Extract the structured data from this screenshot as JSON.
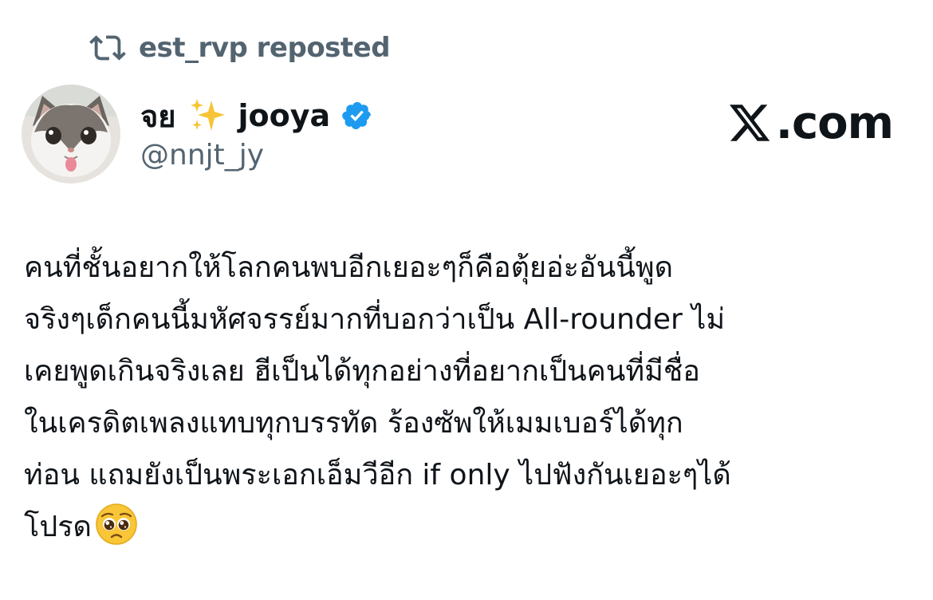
{
  "repost": {
    "icon": "repost-icon",
    "text": "est_rvp reposted"
  },
  "author": {
    "avatar": "cat-avatar",
    "name_part1": "จย",
    "name_emoji": "sparkles-icon",
    "name_part2": "jooya",
    "verified_icon": "verified-badge-icon",
    "verified_color": "#1d9bf0",
    "handle": "@nnjt_jy"
  },
  "brand": {
    "logo": "x-logo-icon",
    "text": ".com"
  },
  "tweet": {
    "lines": [
      "คนที่ชั้นอยากให้โลกคนพบอีกเยอะๆก็คือตุ้ยอ่ะอันนี้พูด",
      "จริงๆเด็กคนนี้มหัศจรรย์มากที่บอกว่าเป็น All-rounder ไม่",
      "เคยพูดเกินจริงเลย ฮีเป็นได้ทุกอย่างที่อยากเป็นคนที่มีชื่อ",
      "ในเครดิตเพลงแทบทุกบรรทัด ร้องซัพให้เมมเบอร์ได้ทุก",
      "ท่อน แถมยังเป็นพระเอกเอ็มวีอีก if only ไปฟังกันเยอะๆได้",
      "โปรด"
    ],
    "end_emoji": "pleading-face-icon"
  },
  "colors": {
    "text": "#0f1419",
    "secondary": "#536471",
    "background": "#ffffff"
  }
}
